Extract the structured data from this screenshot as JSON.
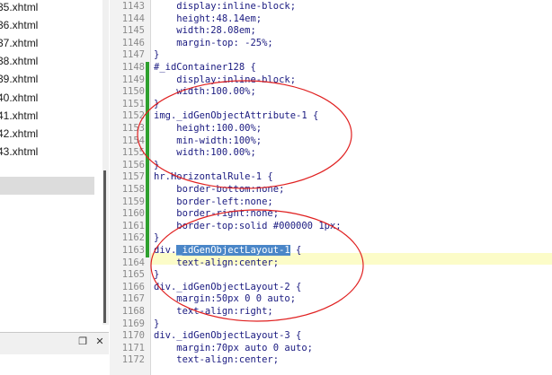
{
  "file_panel": {
    "files": [
      "35.xhtml",
      "36.xhtml",
      "37.xhtml",
      "38.xhtml",
      "39.xhtml",
      "40.xhtml",
      "41.xhtml",
      "42.xhtml",
      "43.xhtml"
    ],
    "restore_icon": "❐",
    "close_icon": "✕"
  },
  "editor": {
    "lines": [
      {
        "n": "1143",
        "t": "    display:inline-block;"
      },
      {
        "n": "1144",
        "t": "    height:48.14em;"
      },
      {
        "n": "1145",
        "t": "    width:28.08em;"
      },
      {
        "n": "1146",
        "t": "    margin-top: -25%;"
      },
      {
        "n": "1147",
        "t": "}"
      },
      {
        "n": "1148",
        "t": "#_idContainer128 {"
      },
      {
        "n": "1149",
        "t": "    display:inline-block;"
      },
      {
        "n": "1150",
        "t": "    width:100.00%;"
      },
      {
        "n": "1151",
        "t": "}"
      },
      {
        "n": "1152",
        "t": "img._idGenObjectAttribute-1 {"
      },
      {
        "n": "1153",
        "t": "    height:100.00%;"
      },
      {
        "n": "1154",
        "t": "    min-width:100%;"
      },
      {
        "n": "1155",
        "t": "    width:100.00%;"
      },
      {
        "n": "1156",
        "t": "}"
      },
      {
        "n": "1157",
        "t": "hr.HorizontalRule-1 {"
      },
      {
        "n": "1158",
        "t": "    border-bottom:none;"
      },
      {
        "n": "1159",
        "t": "    border-left:none;"
      },
      {
        "n": "1160",
        "t": "    border-right:none;"
      },
      {
        "n": "1161",
        "t": "    border-top:solid #000000 1px;"
      },
      {
        "n": "1162",
        "t": "}"
      },
      {
        "n": "1163",
        "t": "div.",
        "sel": "_idGenObjectLayout-1",
        "after": " {"
      },
      {
        "n": "1164",
        "t": "    text-align:center;"
      },
      {
        "n": "1165",
        "t": "}"
      },
      {
        "n": "1166",
        "t": "div._idGenObjectLayout-2 {"
      },
      {
        "n": "1167",
        "t": "    margin:50px 0 0 auto;"
      },
      {
        "n": "1168",
        "t": "    text-align:right;"
      },
      {
        "n": "1169",
        "t": "}"
      },
      {
        "n": "1170",
        "t": "div._idGenObjectLayout-3 {"
      },
      {
        "n": "1171",
        "t": "    margin:70px auto 0 auto;"
      },
      {
        "n": "1172",
        "t": "    text-align:center;"
      }
    ],
    "annotation_color": "#e02020"
  }
}
